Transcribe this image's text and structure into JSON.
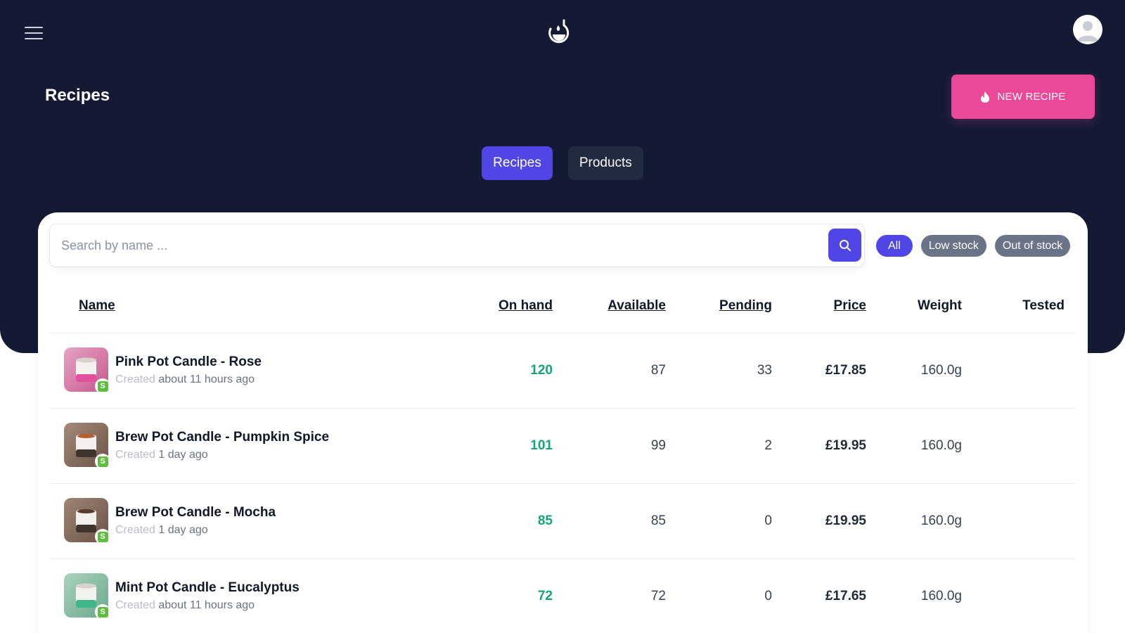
{
  "header": {
    "page_title": "Recipes",
    "new_recipe_label": "NEW RECIPE"
  },
  "tabs": [
    {
      "label": "Recipes",
      "active": true
    },
    {
      "label": "Products",
      "active": false
    }
  ],
  "search": {
    "placeholder": "Search by name ...",
    "value": ""
  },
  "filters": [
    {
      "label": "All",
      "active": true
    },
    {
      "label": "Low stock",
      "active": false
    },
    {
      "label": "Out of stock",
      "active": false
    }
  ],
  "table": {
    "columns": {
      "name": "Name",
      "on_hand": "On hand",
      "available": "Available",
      "pending": "Pending",
      "price": "Price",
      "weight": "Weight",
      "tested": "Tested"
    },
    "rows": [
      {
        "name": "Pink Pot Candle - Rose",
        "created_label": "Created",
        "created_when": "about 11 hours ago",
        "on_hand": "120",
        "available": "87",
        "pending": "33",
        "price": "£17.85",
        "weight": "160.0g",
        "tested": ""
      },
      {
        "name": "Brew Pot Candle - Pumpkin Spice",
        "created_label": "Created",
        "created_when": "1 day ago",
        "on_hand": "101",
        "available": "99",
        "pending": "2",
        "price": "£19.95",
        "weight": "160.0g",
        "tested": ""
      },
      {
        "name": "Brew Pot Candle - Mocha",
        "created_label": "Created",
        "created_when": "1 day ago",
        "on_hand": "85",
        "available": "85",
        "pending": "0",
        "price": "£19.95",
        "weight": "160.0g",
        "tested": ""
      },
      {
        "name": "Mint Pot Candle - Eucalyptus",
        "created_label": "Created",
        "created_when": "about 11 hours ago",
        "on_hand": "72",
        "available": "72",
        "pending": "0",
        "price": "£17.65",
        "weight": "160.0g",
        "tested": ""
      }
    ]
  },
  "colors": {
    "header_bg": "#141a33",
    "accent": "#4f46e5",
    "cta": "#ec4899",
    "on_hand_green": "#16a37a"
  },
  "icons": [
    "menu-icon",
    "logo-icon",
    "user-avatar-icon",
    "flame-icon",
    "search-icon",
    "shopify-icon"
  ]
}
